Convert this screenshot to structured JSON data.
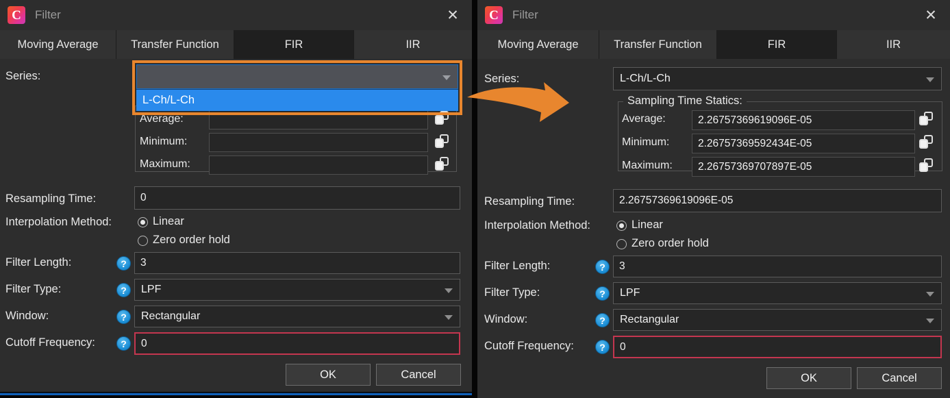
{
  "window": {
    "title": "Filter",
    "app_icon": "C",
    "close_icon": "✕"
  },
  "tabs": [
    {
      "label": "Moving Average",
      "selected": false
    },
    {
      "label": "Transfer Function",
      "selected": false
    },
    {
      "label": "FIR",
      "selected": true
    },
    {
      "label": "IIR",
      "selected": false
    }
  ],
  "labels": {
    "series": "Series:",
    "group_title": "Sampling Time Statics:",
    "average": "Average:",
    "minimum": "Minimum:",
    "maximum": "Maximum:",
    "resampling_time": "Resampling Time:",
    "interpolation_method": "Interpolation Method:",
    "linear": "Linear",
    "zero_order_hold": "Zero order hold",
    "filter_length": "Filter Length:",
    "filter_type": "Filter Type:",
    "window": "Window:",
    "cutoff_frequency": "Cutoff Frequency:"
  },
  "icons": {
    "copy": "copy-icon",
    "help": "?",
    "caret_down": "▼",
    "spin_up": "▲",
    "spin_down": "▼"
  },
  "left_panel": {
    "series_value": "",
    "dropdown_open": true,
    "dropdown_options": [
      "L-Ch/L-Ch"
    ],
    "dropdown_highlighted": "L-Ch/L-Ch",
    "average": "",
    "minimum": "",
    "maximum": "",
    "resampling_time": "0",
    "interpolation_selected": "Linear",
    "filter_length": "3",
    "filter_type": "LPF",
    "window": "Rectangular",
    "cutoff_frequency": "0",
    "ok_label": "OK",
    "cancel_label": "Cancel"
  },
  "right_panel": {
    "series_value": "L-Ch/L-Ch",
    "average": "2.26757369619096E-05",
    "minimum": "2.26757369592434E-05",
    "maximum": "2.26757369707897E-05",
    "resampling_time": "2.26757369619096E-05",
    "interpolation_selected": "Linear",
    "filter_length": "3",
    "filter_type": "LPF",
    "window": "Rectangular",
    "cutoff_frequency": "0",
    "ok_label": "OK",
    "cancel_label": "Cancel"
  },
  "annotations": {
    "highlight_color": "#e8862e",
    "arrow_color": "#e8862e",
    "required_field_color": "#c4364f",
    "selection_color": "#2a8aec"
  }
}
